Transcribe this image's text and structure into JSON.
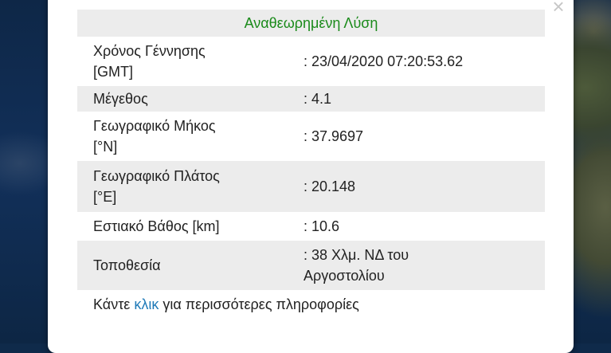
{
  "popup": {
    "title": "Αναθεωρημένη Λύση",
    "close_symbol": "×",
    "rows": [
      {
        "label_line1": "Χρόνος Γέννησης",
        "label_line2": "[GMT]",
        "value": ": 23/04/2020 07:20:53.62"
      },
      {
        "label_line1": "Μέγεθος",
        "label_line2": "",
        "value": ": 4.1"
      },
      {
        "label_line1": "Γεωγραφικό Μήκος",
        "label_line2": "[°N]",
        "value": ": 37.9697"
      },
      {
        "label_line1": "Γεωγραφικό Πλάτος",
        "label_line2": "[°E]",
        "value": ": 20.148"
      },
      {
        "label_line1": "Εστιακό Βάθος [km]",
        "label_line2": "",
        "value": ": 10.6"
      },
      {
        "label_line1": "Τοποθεσία",
        "label_line2": "",
        "value_line1": ": 38 Χλμ. ΝΔ του",
        "value_line2": "Αργοστολίου"
      }
    ],
    "footer": {
      "prefix": "Κάντε",
      "link": "κλικ",
      "suffix": "για περισσότερες πληροφορίες"
    }
  },
  "colors": {
    "title": "#1a8a1a",
    "link": "#1f7ab8",
    "row_alt": "#ececec"
  }
}
